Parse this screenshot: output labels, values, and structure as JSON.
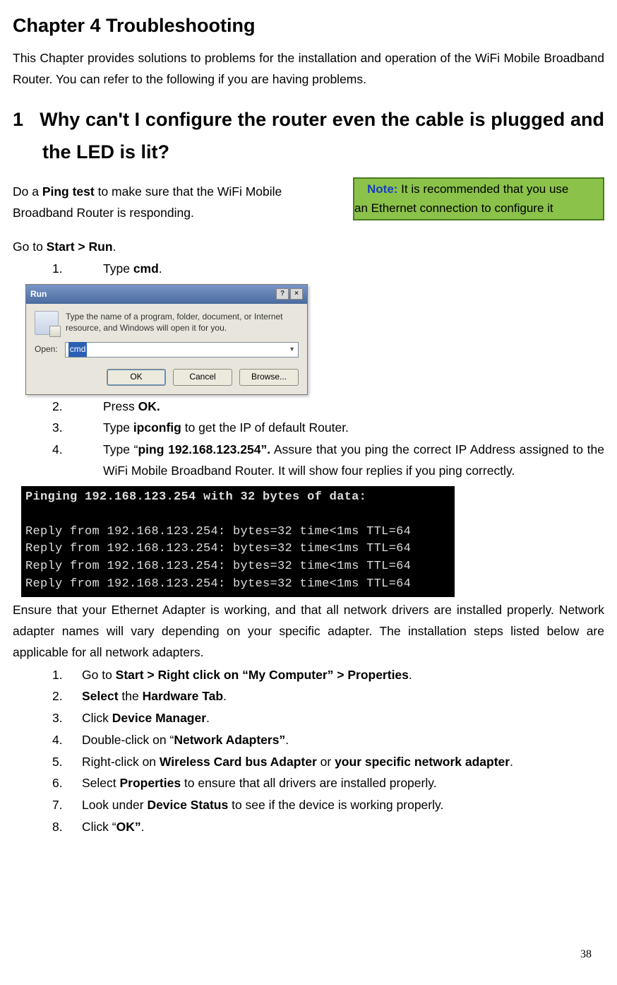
{
  "chapter": "Chapter 4    Troubleshooting",
  "intro": "This Chapter provides solutions to problems for the installation and operation of the WiFi Mobile Broadband Router. You can refer to the following if you are having problems.",
  "section1_num": "1",
  "section1": "Why can't I configure the router even the cable is plugged and the LED is lit?",
  "ping_para1": "Do a ",
  "ping_bold": "Ping test",
  "ping_para2": " to make sure that the WiFi Mobile Broadband Router is responding.",
  "note": {
    "label": "Note:",
    "line1": " It is recommended that you use",
    "line2": "an Ethernet connection to configure it"
  },
  "goto_pre": "Go to ",
  "goto_bold": "Start > Run",
  "goto_post": ".",
  "list_a": [
    {
      "n": "1.",
      "pre": "Type ",
      "b": "cmd",
      "post": "."
    },
    {
      "n": "2.",
      "pre": "Press ",
      "b": "OK.",
      "post": ""
    },
    {
      "n": "3.",
      "pre": "Type ",
      "b": "ipconfig",
      "post": " to get the IP of default Router."
    },
    {
      "n": "4.",
      "pre": "Type “",
      "b": "ping 192.168.123.254”.",
      "post": " Assure that you ping the correct IP Address assigned to the WiFi Mobile Broadband Router. It will show four replies if you ping correctly."
    }
  ],
  "run_dialog": {
    "title": "Run",
    "help": "?",
    "close": "×",
    "desc": "Type the name of a program, folder, document, or Internet resource, and Windows will open it for you.",
    "open_label": "Open:",
    "value": "cmd",
    "buttons": {
      "ok": "OK",
      "cancel": "Cancel",
      "browse": "Browse..."
    }
  },
  "cmd_lines": [
    "Pinging 192.168.123.254 with 32 bytes of data:",
    "",
    "Reply from 192.168.123.254: bytes=32 time<1ms TTL=64",
    "Reply from 192.168.123.254: bytes=32 time<1ms TTL=64",
    "Reply from 192.168.123.254: bytes=32 time<1ms TTL=64",
    "Reply from 192.168.123.254: bytes=32 time<1ms TTL=64"
  ],
  "ensure_para": "Ensure that your Ethernet Adapter is working, and that all network drivers are installed properly. Network adapter names will vary depending on your specific adapter. The installation steps listed below are applicable for all network adapters.",
  "list_b": [
    {
      "n": "1.",
      "segs": [
        {
          "t": "Go to "
        },
        {
          "t": "Start > Right click on “My Computer” > Properties",
          "b": true
        },
        {
          "t": "."
        }
      ]
    },
    {
      "n": "2.",
      "segs": [
        {
          "t": "Select",
          "b": true
        },
        {
          "t": " the "
        },
        {
          "t": "Hardware Tab",
          "b": true
        },
        {
          "t": "."
        }
      ]
    },
    {
      "n": "3.",
      "segs": [
        {
          "t": "Click "
        },
        {
          "t": "Device Manager",
          "b": true
        },
        {
          "t": "."
        }
      ]
    },
    {
      "n": "4.",
      "segs": [
        {
          "t": "Double-click on “"
        },
        {
          "t": "Network Adapters”",
          "b": true
        },
        {
          "t": "."
        }
      ]
    },
    {
      "n": "5.",
      "segs": [
        {
          "t": "Right-click on "
        },
        {
          "t": "Wireless Card bus Adapter",
          "b": true
        },
        {
          "t": " or "
        },
        {
          "t": "your specific network adapter",
          "b": true
        },
        {
          "t": "."
        }
      ]
    },
    {
      "n": "6.",
      "segs": [
        {
          "t": "Select "
        },
        {
          "t": "Properties",
          "b": true
        },
        {
          "t": " to ensure that all drivers are installed properly."
        }
      ]
    },
    {
      "n": "7.",
      "segs": [
        {
          "t": "Look under "
        },
        {
          "t": "Device Status",
          "b": true
        },
        {
          "t": " to see if the device is working properly."
        }
      ]
    },
    {
      "n": "8.",
      "segs": [
        {
          "t": "Click “"
        },
        {
          "t": "OK”",
          "b": true
        },
        {
          "t": "."
        }
      ]
    }
  ],
  "page_number": "38"
}
